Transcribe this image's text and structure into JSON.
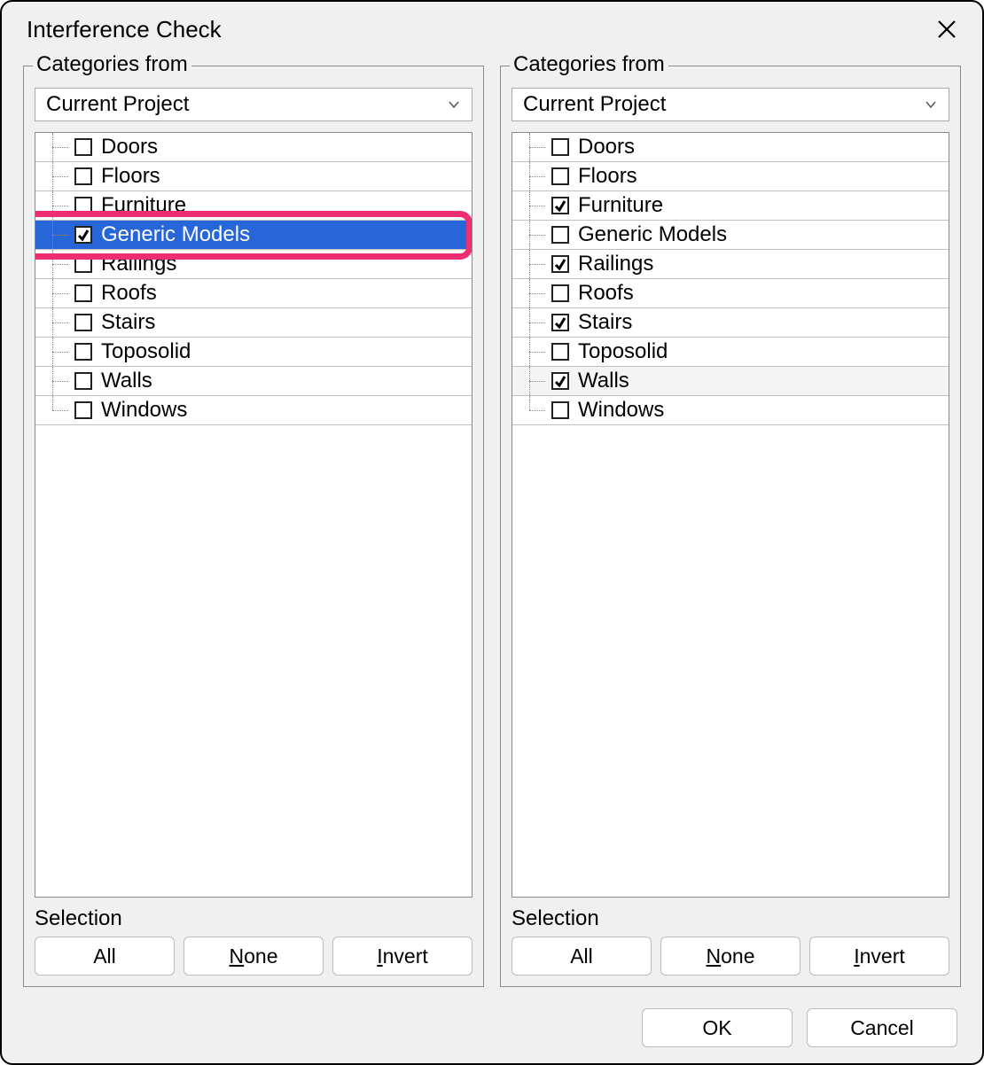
{
  "dialog": {
    "title": "Interference Check"
  },
  "panels": {
    "legend": "Categories from",
    "dropdown_value": "Current Project",
    "selection_label": "Selection"
  },
  "left": {
    "items": [
      {
        "label": "Doors",
        "checked": false,
        "selected": false
      },
      {
        "label": "Floors",
        "checked": false,
        "selected": false
      },
      {
        "label": "Furniture",
        "checked": false,
        "selected": false
      },
      {
        "label": "Generic Models",
        "checked": true,
        "selected": true,
        "highlighted": true
      },
      {
        "label": "Railings",
        "checked": false,
        "selected": false
      },
      {
        "label": "Roofs",
        "checked": false,
        "selected": false
      },
      {
        "label": "Stairs",
        "checked": false,
        "selected": false
      },
      {
        "label": "Toposolid",
        "checked": false,
        "selected": false
      },
      {
        "label": "Walls",
        "checked": false,
        "selected": false
      },
      {
        "label": "Windows",
        "checked": false,
        "selected": false
      }
    ]
  },
  "right": {
    "items": [
      {
        "label": "Doors",
        "checked": false
      },
      {
        "label": "Floors",
        "checked": false
      },
      {
        "label": "Furniture",
        "checked": true
      },
      {
        "label": "Generic Models",
        "checked": false
      },
      {
        "label": "Railings",
        "checked": true
      },
      {
        "label": "Roofs",
        "checked": false
      },
      {
        "label": "Stairs",
        "checked": true
      },
      {
        "label": "Toposolid",
        "checked": false
      },
      {
        "label": "Walls",
        "checked": true,
        "hover": true
      },
      {
        "label": "Windows",
        "checked": false
      }
    ]
  },
  "buttons": {
    "all": "All",
    "none_pre": "N",
    "none_post": "one",
    "invert_pre": "I",
    "invert_post": "nvert",
    "ok": "OK",
    "cancel": "Cancel"
  }
}
